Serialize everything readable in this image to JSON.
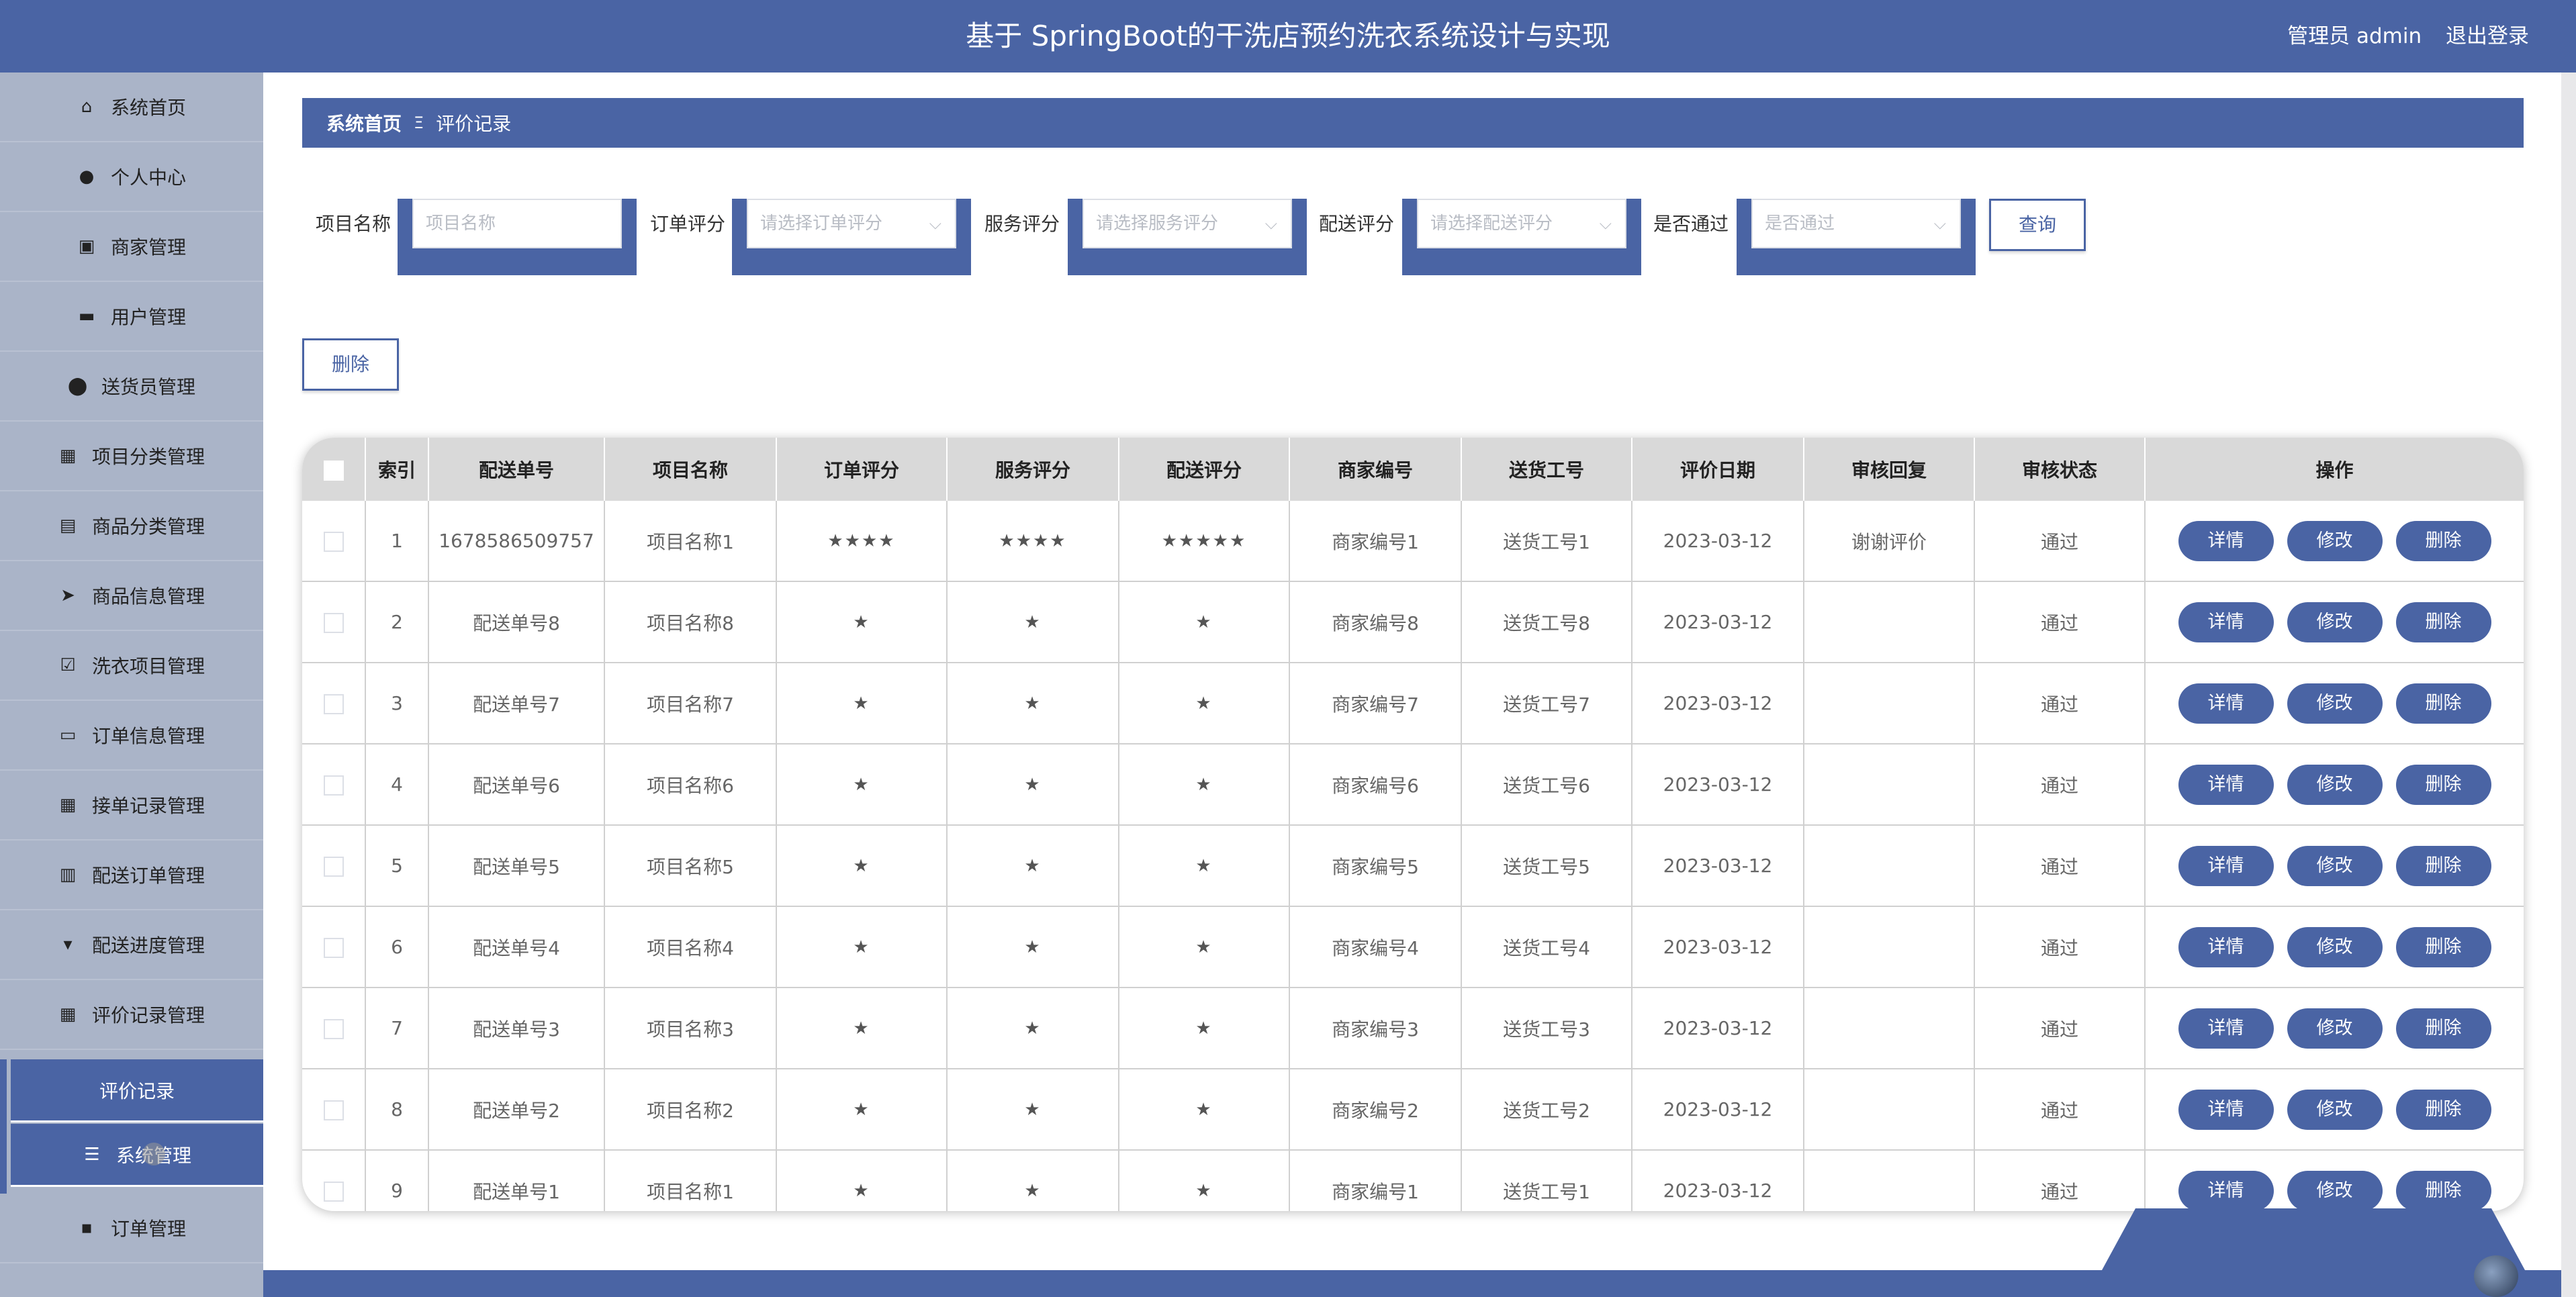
{
  "header": {
    "title": "基于 SpringBoot的干洗店预约洗衣系统设计与实现",
    "user_label": "管理员 admin",
    "logout_label": "退出登录"
  },
  "sidebar": {
    "items": [
      {
        "label": "系统首页",
        "icon": "home-icon",
        "glyph": "⌂"
      },
      {
        "label": "个人中心",
        "icon": "user-icon",
        "glyph": "●"
      },
      {
        "label": "商家管理",
        "icon": "chart-icon",
        "glyph": "▣"
      },
      {
        "label": "用户管理",
        "icon": "chair-icon",
        "glyph": "▬"
      },
      {
        "label": "送货员管理",
        "icon": "pin-icon",
        "glyph": "⬤"
      },
      {
        "label": "项目分类管理",
        "icon": "grid-icon",
        "glyph": "▦"
      },
      {
        "label": "商品分类管理",
        "icon": "clipboard-icon",
        "glyph": "▤"
      },
      {
        "label": "商品信息管理",
        "icon": "send-icon",
        "glyph": "➤"
      },
      {
        "label": "洗衣项目管理",
        "icon": "check-clipboard-icon",
        "glyph": "☑"
      },
      {
        "label": "订单信息管理",
        "icon": "briefcase-icon",
        "glyph": "▭"
      },
      {
        "label": "接单记录管理",
        "icon": "grid-icon",
        "glyph": "▦"
      },
      {
        "label": "配送订单管理",
        "icon": "books-icon",
        "glyph": "▥"
      },
      {
        "label": "配送进度管理",
        "icon": "flag-icon",
        "glyph": "▾"
      },
      {
        "label": "评价记录管理",
        "icon": "grid-icon",
        "glyph": "▦"
      },
      {
        "label": "评价记录",
        "icon": "",
        "glyph": ""
      },
      {
        "label": "系统管理",
        "icon": "sliders-icon",
        "glyph": "☰"
      },
      {
        "label": "订单管理",
        "icon": "comment-icon",
        "glyph": "▪"
      }
    ]
  },
  "breadcrumb": {
    "home": "系统首页",
    "separator": "Ξ",
    "current": "评价记录"
  },
  "search": {
    "project_label": "项目名称",
    "project_placeholder": "项目名称",
    "order_rating_label": "订单评分",
    "order_rating_placeholder": "请选择订单评分",
    "service_rating_label": "服务评分",
    "service_rating_placeholder": "请选择服务评分",
    "delivery_rating_label": "配送评分",
    "delivery_rating_placeholder": "请选择配送评分",
    "passed_label": "是否通过",
    "passed_placeholder": "是否通过",
    "query_label": "查询"
  },
  "toolbar": {
    "delete_label": "删除"
  },
  "table": {
    "headers": [
      "索引",
      "配送单号",
      "项目名称",
      "订单评分",
      "服务评分",
      "配送评分",
      "商家编号",
      "送货工号",
      "评价日期",
      "审核回复",
      "审核状态",
      "操作"
    ],
    "rows": [
      [
        "1",
        "1678586509757",
        "项目名称1",
        "★★★★",
        "★★★★",
        "★★★★★",
        "商家编号1",
        "送货工号1",
        "2023-03-12",
        "谢谢评价",
        "通过"
      ],
      [
        "2",
        "配送单号8",
        "项目名称8",
        "★",
        "★",
        "★",
        "商家编号8",
        "送货工号8",
        "2023-03-12",
        "",
        "通过"
      ],
      [
        "3",
        "配送单号7",
        "项目名称7",
        "★",
        "★",
        "★",
        "商家编号7",
        "送货工号7",
        "2023-03-12",
        "",
        "通过"
      ],
      [
        "4",
        "配送单号6",
        "项目名称6",
        "★",
        "★",
        "★",
        "商家编号6",
        "送货工号6",
        "2023-03-12",
        "",
        "通过"
      ],
      [
        "5",
        "配送单号5",
        "项目名称5",
        "★",
        "★",
        "★",
        "商家编号5",
        "送货工号5",
        "2023-03-12",
        "",
        "通过"
      ],
      [
        "6",
        "配送单号4",
        "项目名称4",
        "★",
        "★",
        "★",
        "商家编号4",
        "送货工号4",
        "2023-03-12",
        "",
        "通过"
      ],
      [
        "7",
        "配送单号3",
        "项目名称3",
        "★",
        "★",
        "★",
        "商家编号3",
        "送货工号3",
        "2023-03-12",
        "",
        "通过"
      ],
      [
        "8",
        "配送单号2",
        "项目名称2",
        "★",
        "★",
        "★",
        "商家编号2",
        "送货工号2",
        "2023-03-12",
        "",
        "通过"
      ],
      [
        "9",
        "配送单号1",
        "项目名称1",
        "★",
        "★",
        "★",
        "商家编号1",
        "送货工号1",
        "2023-03-12",
        "",
        "通过"
      ]
    ],
    "actions": [
      "详情",
      "修改",
      "删除"
    ]
  },
  "colors": {
    "primary": "#4a64a4",
    "sidebar_bg": "#aab4c8",
    "header_bg": "#d9d9d9"
  }
}
